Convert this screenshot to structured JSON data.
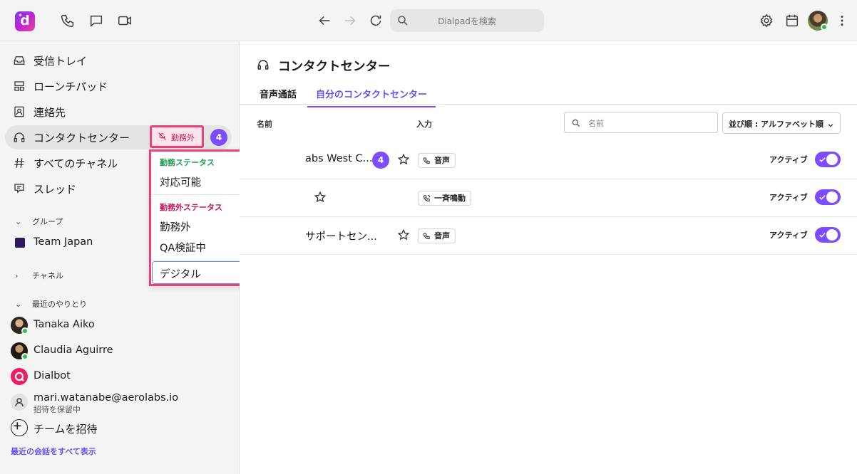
{
  "topbar": {
    "logo_letter": "d",
    "search_placeholder": "Dialpadを検索",
    "icons": [
      "phone-icon",
      "chat-icon",
      "video-icon",
      "back-icon",
      "forward-icon",
      "refresh-icon",
      "search-icon",
      "settings-icon",
      "calendar-icon",
      "more-icon"
    ]
  },
  "sidebar": {
    "nav": [
      {
        "label": "受信トレイ",
        "icon": "inbox-icon"
      },
      {
        "label": "ローンチパッド",
        "icon": "launchpad-icon"
      },
      {
        "label": "連絡先",
        "icon": "contacts-icon"
      },
      {
        "label": "コンタクトセンター",
        "icon": "headset-icon"
      },
      {
        "label": "すべてのチャネル",
        "icon": "hash-icon"
      },
      {
        "label": "スレッド",
        "icon": "threads-icon"
      }
    ],
    "status_chip": "勤務外",
    "count_badge": "4",
    "groups_head": "グループ",
    "team": "Team Japan",
    "channels_head": "チャネル",
    "recent_head": "最近のやりとり",
    "recent": [
      {
        "name": "Tanaka Aiko"
      },
      {
        "name": "Claudia Aguirre"
      },
      {
        "name": "Dialbot"
      }
    ],
    "pending_email": "mari.watanabe@aerolabs.io",
    "pending_note": "招待を保留中",
    "invite": "チームを招待",
    "show_all": "最近の会話をすべて表示"
  },
  "dropdown": {
    "on_duty_head": "勤務ステータス",
    "on_duty_items": [
      "対応可能"
    ],
    "off_duty_head": "勤務外ステータス",
    "off_duty_items": [
      "勤務外",
      "QA検証中"
    ],
    "digital": "デジタル",
    "selected": "勤務外",
    "colors": {
      "on_duty": "#1f9d55",
      "off_duty": "#c2185b"
    }
  },
  "main": {
    "title": "コンタクトセンター",
    "tabs": [
      "音声通話",
      "自分のコンタクトセンター"
    ],
    "selected_tab": "自分のコンタクトセンター",
    "col_name": "名前",
    "col_input": "入力",
    "search_placeholder": "名前",
    "sort_label": "並び順 : アルファベット順",
    "rows": [
      {
        "name": "abs West C...",
        "badge": "4",
        "channel": "音声",
        "status": "アクティブ"
      },
      {
        "name": "",
        "badge": "",
        "channel": "一斉鳴動",
        "status": "アクティブ"
      },
      {
        "name": "サポートセン...",
        "badge": "",
        "channel": "音声",
        "status": "アクティブ"
      }
    ],
    "accent": "#7c4dff"
  }
}
